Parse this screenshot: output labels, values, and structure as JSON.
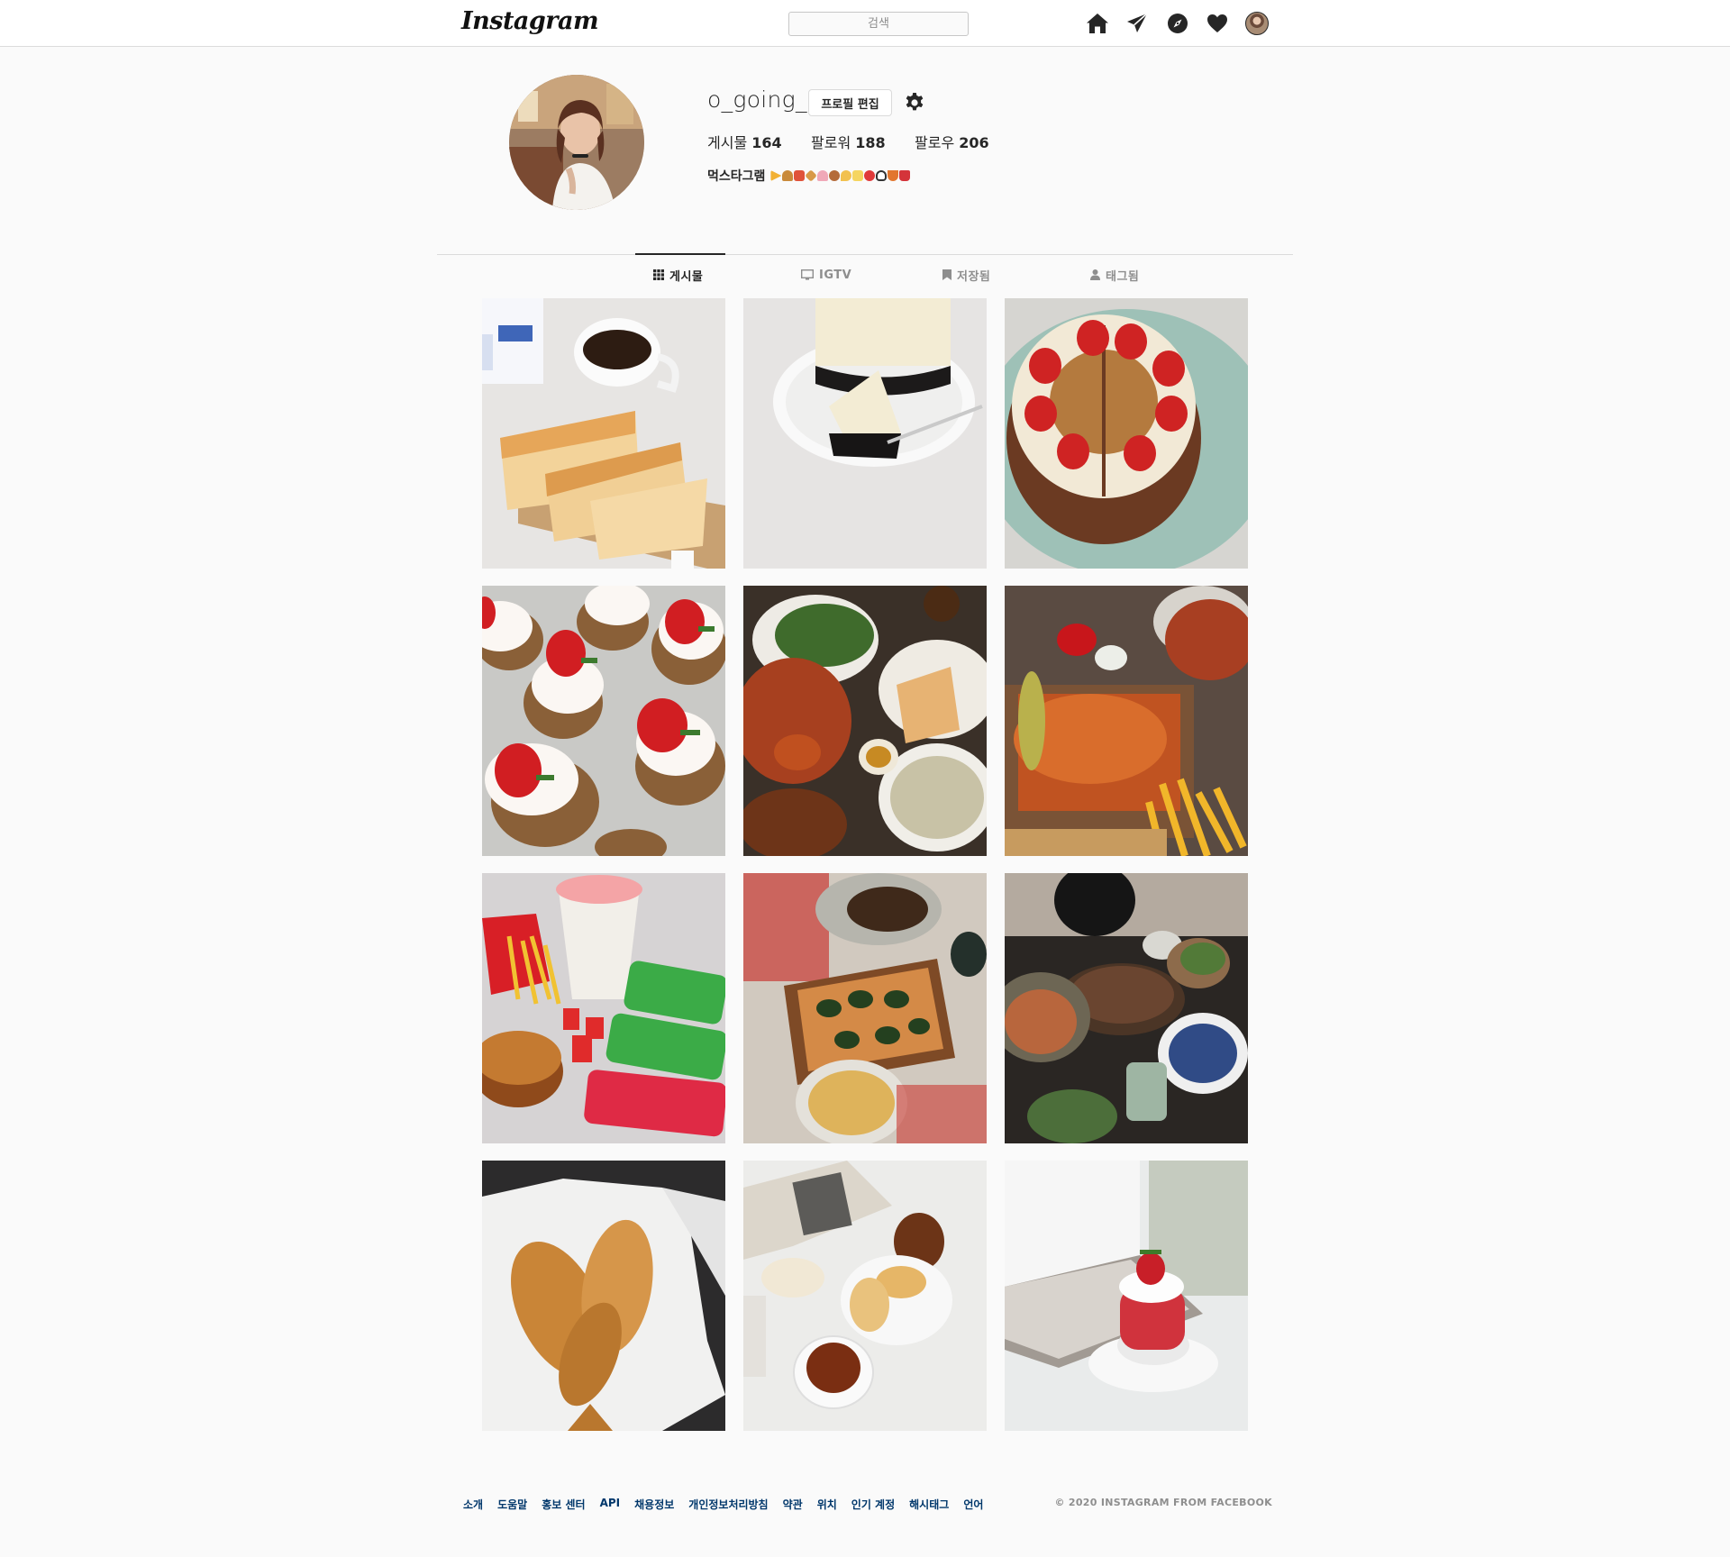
{
  "header": {
    "logo": "Instagram",
    "search_placeholder": "검색",
    "icons": [
      "home-icon",
      "direct-icon",
      "explore-icon",
      "activity-icon",
      "profile-avatar-icon"
    ]
  },
  "profile": {
    "username": "o_going_",
    "edit_button": "프로필 편집",
    "stats": {
      "posts_label": "게시물",
      "posts": "164",
      "followers_label": "팔로워",
      "followers": "188",
      "following_label": "팔로우",
      "following": "206"
    },
    "bio": "먹스타그램"
  },
  "tabs": [
    {
      "label": "게시물",
      "icon": "grid-icon",
      "active": true
    },
    {
      "label": "IGTV",
      "icon": "tv-icon",
      "active": false
    },
    {
      "label": "저장됨",
      "icon": "bookmark-icon",
      "active": false
    },
    {
      "label": "태그됨",
      "icon": "user-tag-icon",
      "active": false
    }
  ],
  "posts": [
    {
      "subject": "toast-and-coffee"
    },
    {
      "subject": "cheesecake"
    },
    {
      "subject": "strawberry-cake"
    },
    {
      "subject": "strawberry-cupcakes"
    },
    {
      "subject": "seafood-platter"
    },
    {
      "subject": "lobster-and-fries"
    },
    {
      "subject": "mcdonalds-meal"
    },
    {
      "subject": "pizza-and-pasta"
    },
    {
      "subject": "asian-dinner-table"
    },
    {
      "subject": "fish-shaped-bread"
    },
    {
      "subject": "cafe-bread-and-tea"
    },
    {
      "subject": "strawberry-dessert"
    }
  ],
  "footer": {
    "links": [
      "소개",
      "도움말",
      "홍보 센터",
      "API",
      "채용정보",
      "개인정보처리방침",
      "약관",
      "위치",
      "인기 계정",
      "해시태그",
      "언어"
    ],
    "copyright": "© 2020 INSTAGRAM FROM FACEBOOK"
  },
  "colors": {
    "background": "#fafafa",
    "text": "#262626",
    "muted": "#8e8e8e",
    "border": "#dbdbdb",
    "link": "#00376b"
  }
}
